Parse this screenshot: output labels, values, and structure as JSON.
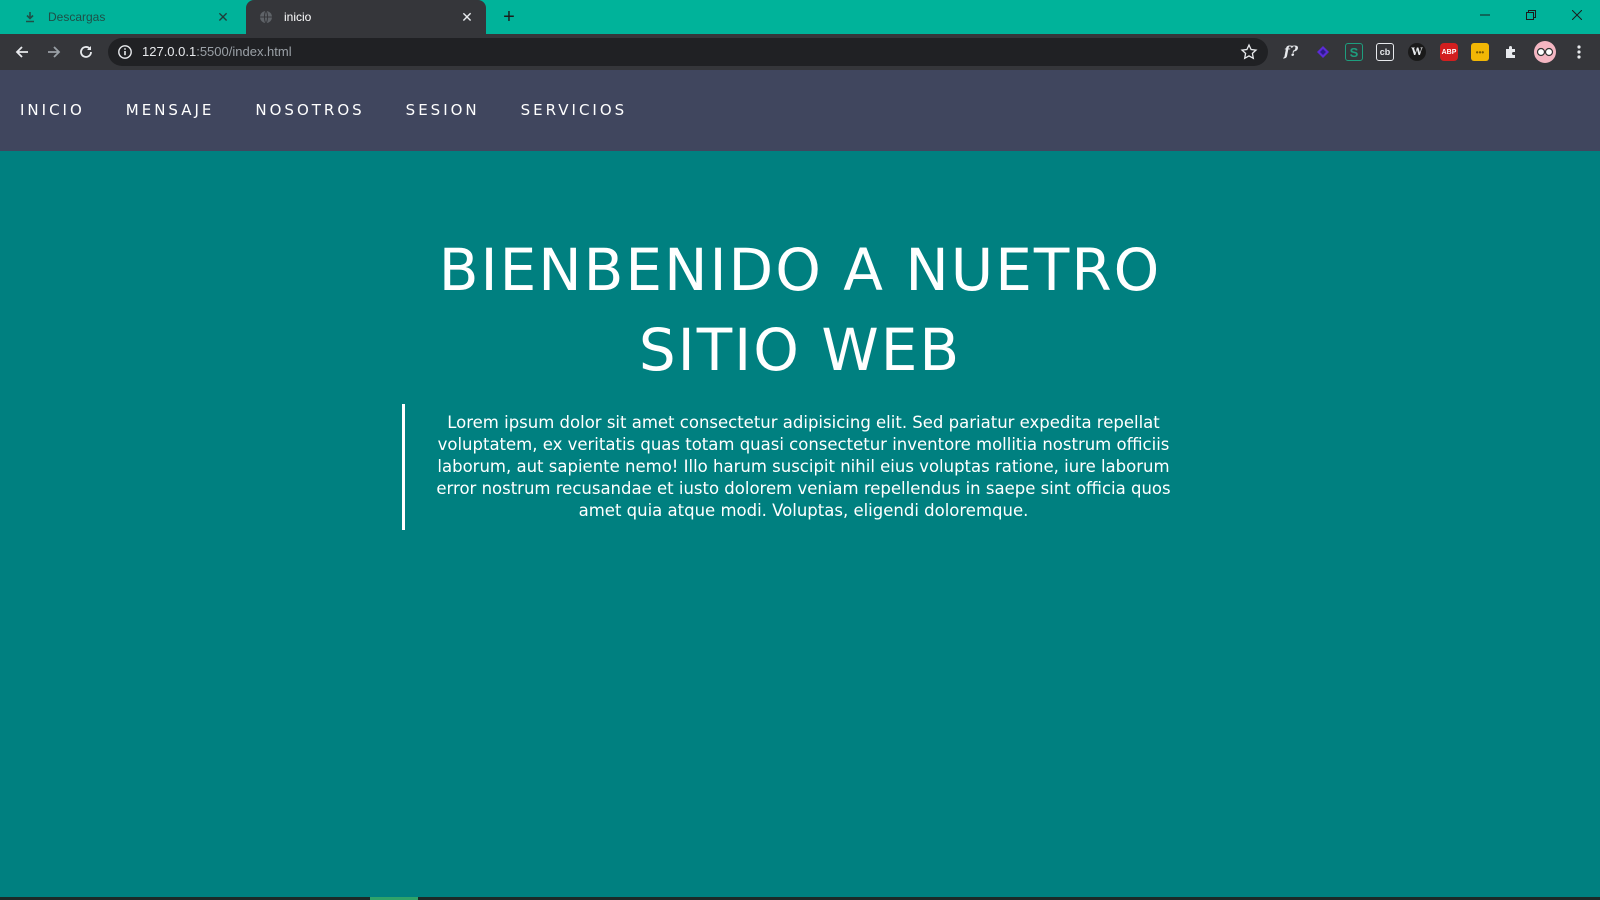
{
  "browser": {
    "tabs": [
      {
        "title": "Descargas",
        "icon": "download-icon",
        "active": false
      },
      {
        "title": "inicio",
        "icon": "globe-icon",
        "active": true
      }
    ],
    "address": {
      "host": "127.0.0.1",
      "rest": ":5500/index.html"
    },
    "extensions": [
      {
        "name": "fx-icon",
        "label": "f?",
        "color": "#e8eaed"
      },
      {
        "name": "purple-extension-icon",
        "label": "",
        "color": "#5b2bd6"
      },
      {
        "name": "s-extension-icon",
        "label": "S",
        "color": "#1e9e7e"
      },
      {
        "name": "cb-extension-icon",
        "label": "cb",
        "color": "#e8eaed"
      },
      {
        "name": "w-extension-icon",
        "label": "W",
        "color": "#e8eaed"
      },
      {
        "name": "abp-icon",
        "label": "ABP",
        "color": "#d21f1f"
      },
      {
        "name": "yellow-extension-icon",
        "label": "•••",
        "color": "#f2b705"
      },
      {
        "name": "puzzle-icon",
        "label": "",
        "color": "#e8eaed"
      }
    ]
  },
  "site": {
    "nav": [
      "INICIO",
      "MENSAJE",
      "NOSOTROS",
      "SESION",
      "SERVICIOS"
    ],
    "hero": {
      "title_line1": "BIENBENIDO A NUETRO",
      "title_line2": "SITIO WEB",
      "text": "Lorem ipsum dolor sit amet consectetur adipisicing elit. Sed pariatur expedita repellat voluptatem, ex veritatis quas totam quasi consectetur inventore mollitia nostrum officiis laborum, aut sapiente nemo! Illo harum suscipit nihil eius voluptas ratione, iure laborum error nostrum recusandae et iusto dolorem veniam repellendus in saepe sint officia quos amet quia atque modi. Voluptas, eligendi doloremque."
    }
  },
  "colors": {
    "tabstrip": "#00b39a",
    "toolbar": "#35363a",
    "site_nav": "#40465e",
    "page_bg": "#008080",
    "text": "#ffffff"
  }
}
